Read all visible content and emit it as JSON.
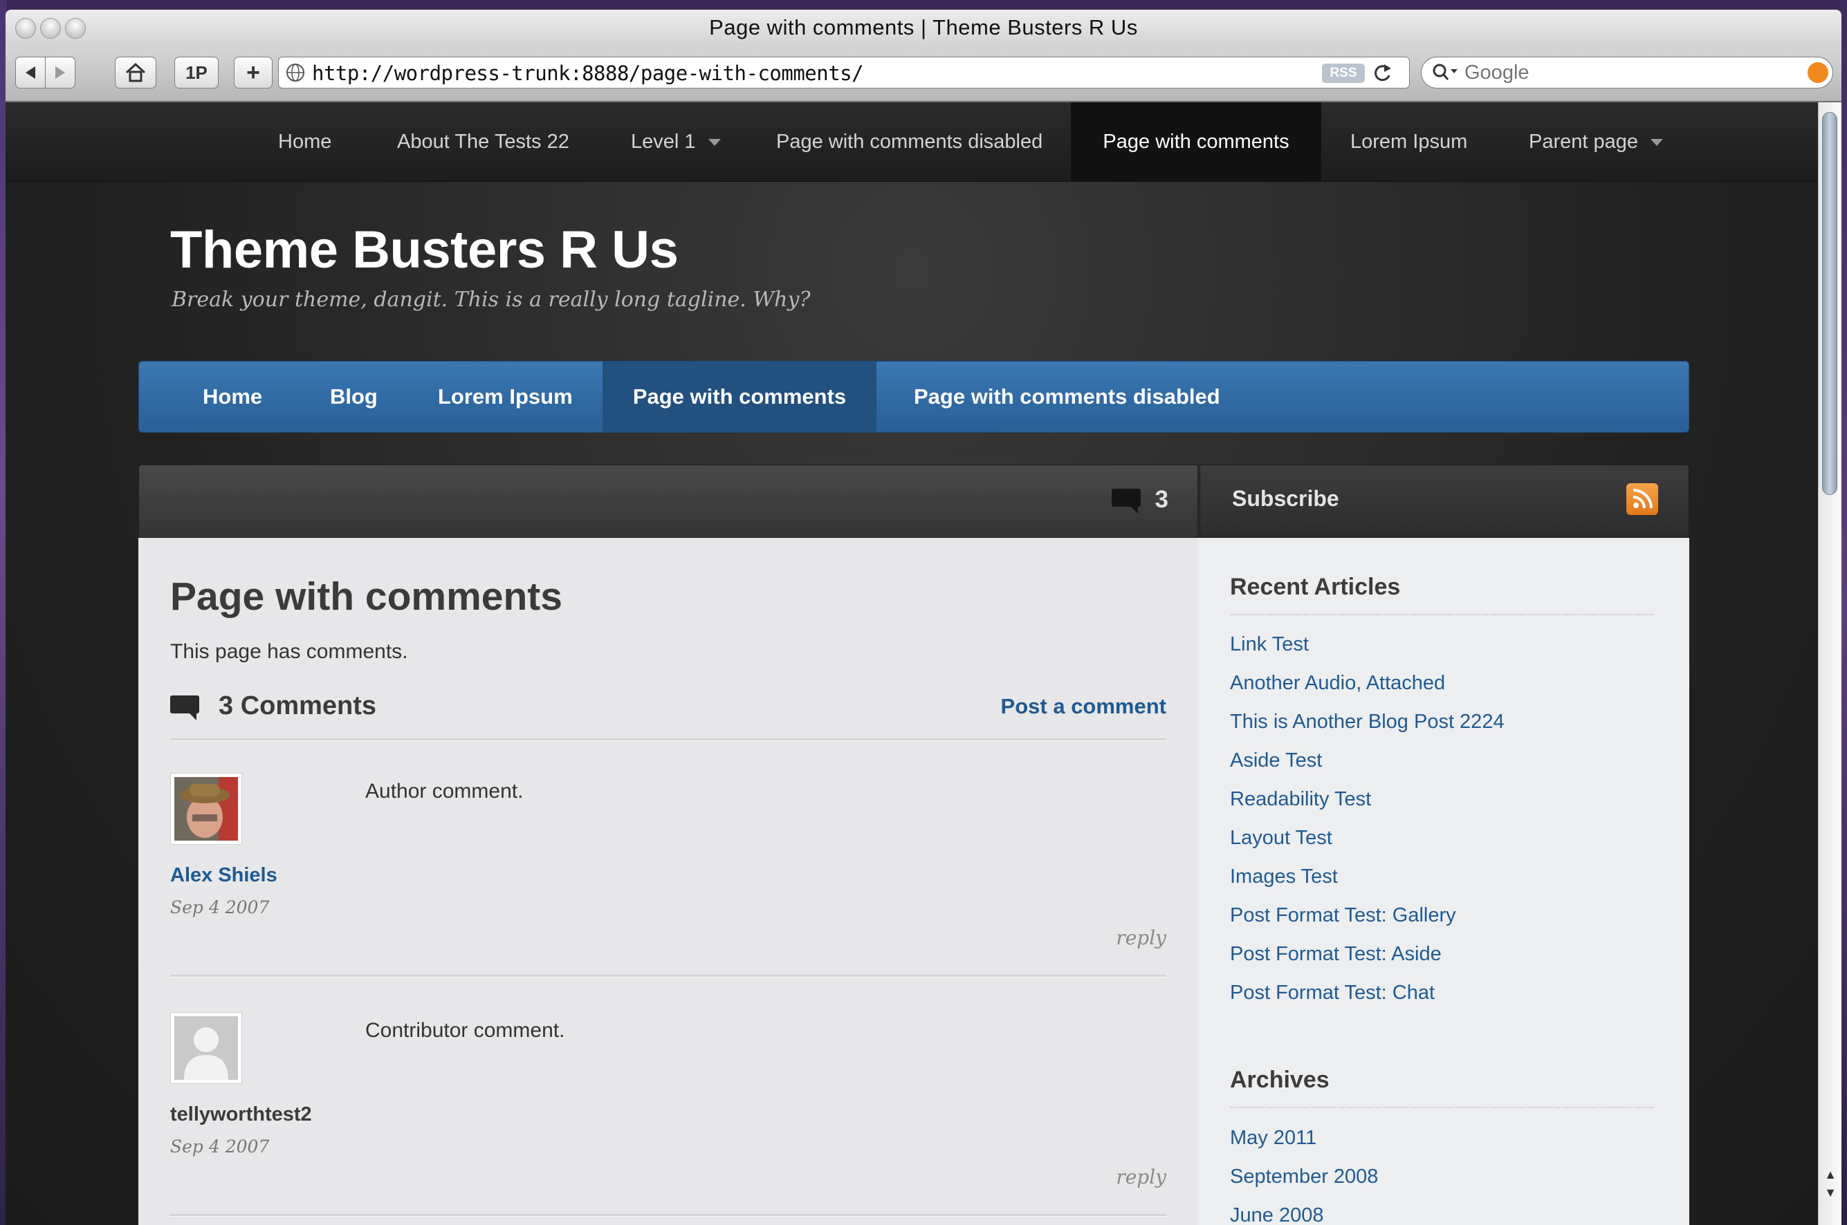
{
  "window": {
    "title": "Page with comments | Theme Busters R Us"
  },
  "toolbar": {
    "back": "◀",
    "forward": "▶",
    "home_icon": "home-icon",
    "onepassword": "1P",
    "add": "+",
    "url": "http://wordpress-trunk:8888/page-with-comments/",
    "rss_badge": "RSS",
    "search_placeholder": "Google"
  },
  "topnav": {
    "items": [
      {
        "label": "Home"
      },
      {
        "label": "About The Tests 22"
      },
      {
        "label": "Level 1"
      },
      {
        "label": "Page with comments disabled"
      },
      {
        "label": "Page with comments"
      },
      {
        "label": "Lorem Ipsum"
      },
      {
        "label": "Parent page"
      }
    ]
  },
  "site": {
    "title": "Theme Busters R Us",
    "tagline": "Break your theme, dangit. This is a really long tagline. Why?"
  },
  "mainnav": {
    "items": [
      {
        "label": "Home"
      },
      {
        "label": "Blog"
      },
      {
        "label": "Lorem Ipsum"
      },
      {
        "label": "Page with comments"
      },
      {
        "label": "Page with comments disabled"
      }
    ]
  },
  "header": {
    "comment_count": "3",
    "subscribe": "Subscribe"
  },
  "page": {
    "title": "Page with comments",
    "text": "This page has comments.",
    "comments_title": "3 Comments",
    "post_comment": "Post a comment"
  },
  "comments": [
    {
      "author": "Alex Shiels",
      "date": "Sep 4 2007",
      "body": "Author comment.",
      "reply": "reply",
      "author_color": "#1f5a92"
    },
    {
      "author": "tellyworthtest2",
      "date": "Sep 4 2007",
      "body": "Contributor comment.",
      "reply": "reply",
      "author_color": "#3b3b3b"
    }
  ],
  "sidebar": {
    "recent_title": "Recent Articles",
    "recent": [
      "Link Test",
      "Another Audio, Attached",
      "This is Another Blog Post 2224",
      "Aside Test",
      "Readability Test",
      "Layout Test",
      "Images Test",
      "Post Format Test: Gallery",
      "Post Format Test: Aside",
      "Post Format Test: Chat"
    ],
    "archives_title": "Archives",
    "archives": [
      "May 2011",
      "September 2008",
      "June 2008"
    ]
  },
  "colors": {
    "link": "#1f5a92",
    "nav_blue": "#2f6aa5",
    "rss_orange": "#ef8a2a"
  }
}
